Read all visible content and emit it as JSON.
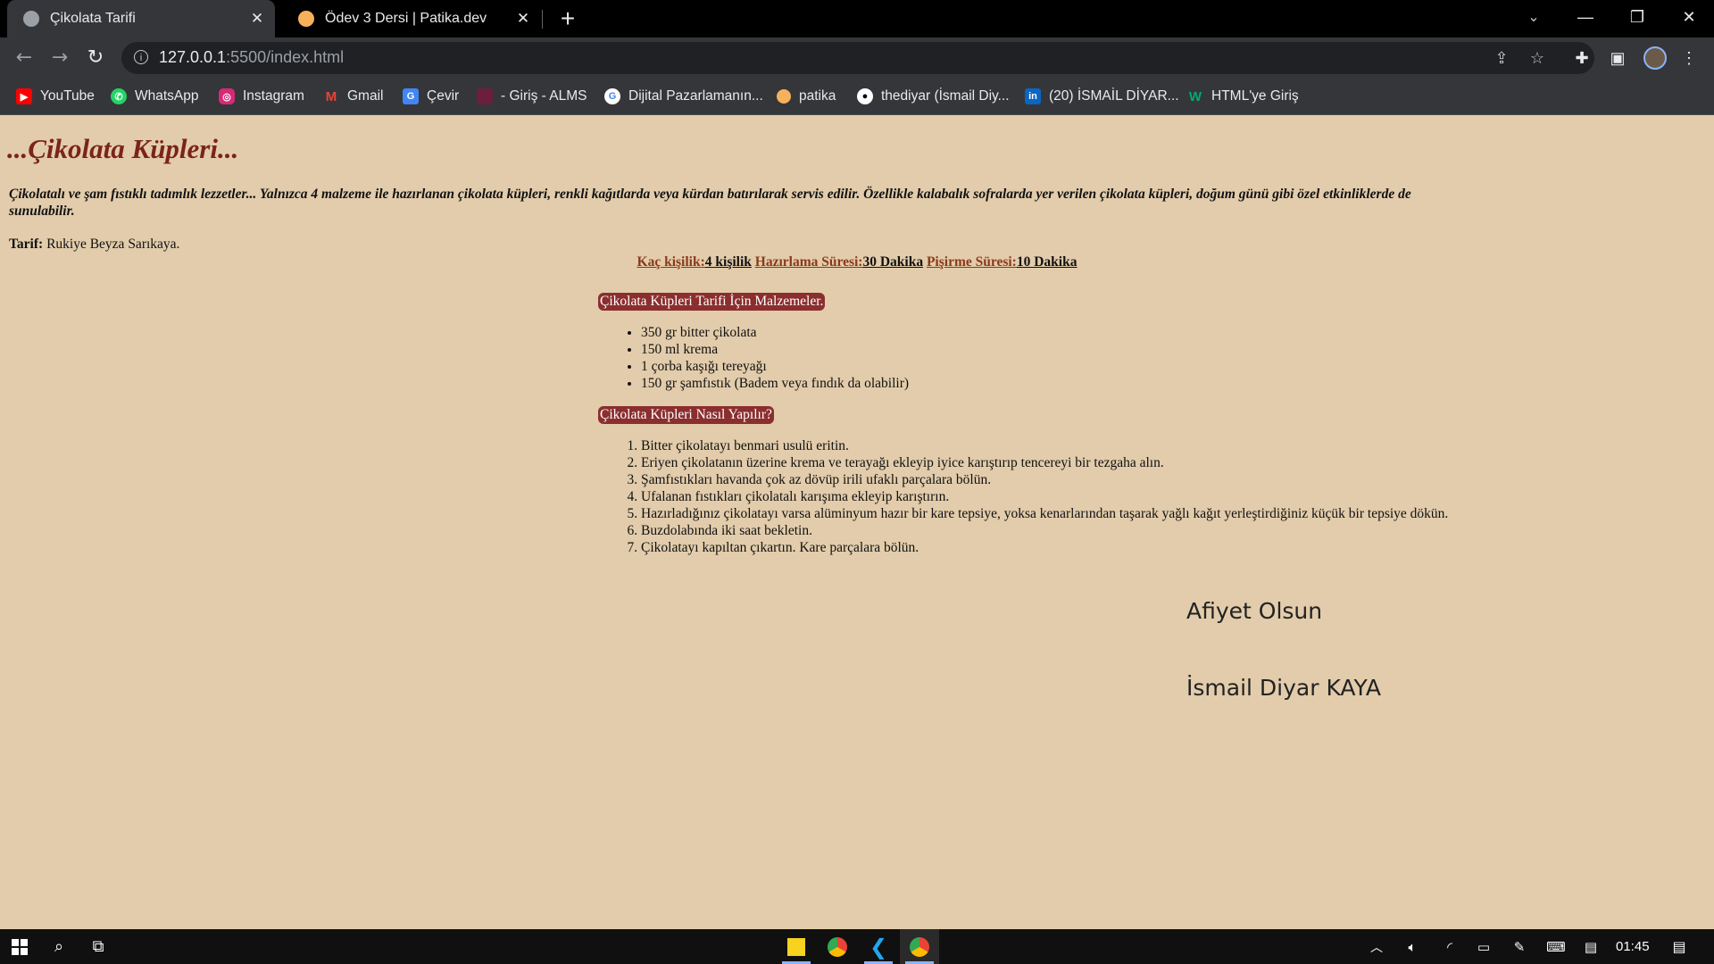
{
  "browser": {
    "tabs": [
      {
        "title": "Çikolata Tarifi",
        "favicon": "globe-icon",
        "active": true
      },
      {
        "title": "Ödev 3 Dersi | Patika.dev",
        "favicon": "patika-icon",
        "active": false
      }
    ],
    "url_host": "127.0.0.1",
    "url_path": ":5500/index.html",
    "bookmarks": [
      {
        "label": "YouTube",
        "icon": "youtube-icon",
        "color": "#ff0000"
      },
      {
        "label": "WhatsApp",
        "icon": "whatsapp-icon",
        "color": "#25d366"
      },
      {
        "label": "Instagram",
        "icon": "instagram-icon",
        "color": "#d62976"
      },
      {
        "label": "Gmail",
        "icon": "gmail-icon",
        "color": "#ea4335"
      },
      {
        "label": "Çevir",
        "icon": "translate-icon",
        "color": "#4285f4"
      },
      {
        "label": "- Giriş - ALMS",
        "icon": "alms-icon",
        "color": "#6b1f3d"
      },
      {
        "label": "Dijital Pazarlamanın...",
        "icon": "google-icon",
        "color": "#ffffff"
      },
      {
        "label": "patika",
        "icon": "patika-icon",
        "color": "#f7b15c"
      },
      {
        "label": "thediyar (İsmail Diy...",
        "icon": "github-icon",
        "color": "#ffffff"
      },
      {
        "label": "(20) İSMAİL DİYAR...",
        "icon": "linkedin-icon",
        "color": "#0a66c2"
      },
      {
        "label": "HTML'ye Giriş",
        "icon": "w3schools-icon",
        "color": "#04aa6d"
      }
    ]
  },
  "page": {
    "title": "...Çikolata Küpleri...",
    "intro": "Çikolatalı ve şam fıstıklı tadımlık lezzetler... Yalnızca 4 malzeme ile hazırlanan çikolata küpleri, renkli kağıtlarda veya kürdan batırılarak servis edilir. Özellikle kalabalık sofralarda yer verilen çikolata küpleri, doğum günü gibi özel etkinliklerde de sunulabilir.",
    "recipe_label": "Tarif:",
    "recipe_author": " Rukiye Beyza Sarıkaya.",
    "meta": {
      "servings_label": "Kaç kişilik:",
      "servings_value": "4 kişilik",
      "prep_label": "Hazırlama Süresi:",
      "prep_value": "30 Dakika",
      "cook_label": "Pişirme Süresi:",
      "cook_value": "10 Dakika"
    },
    "ingredients_heading": "Çikolata Küpleri Tarifi İçin Malzemeler.",
    "ingredients": [
      "350 gr bitter çikolata",
      "150 ml krema",
      "1 çorba kaşığı tereyağı",
      "150 gr şamfıstık (Badem veya fındık da olabilir)"
    ],
    "steps_heading": "Çikolata Küpleri Nasıl Yapılır?",
    "steps": [
      "Bitter çikolatayı benmari usulü eritin.",
      "Eriyen çikolatanın üzerine krema ve terayağı ekleyip iyice karıştırıp tencereyi bir tezgaha alın.",
      "Şamfıstıkları havanda çok az dövüp irili ufaklı parçalara bölün.",
      "Ufalanan fıstıkları çikolatalı karışıma ekleyip karıştırın.",
      "Hazırladığınız çikolatayı varsa alüminyum hazır bir kare tepsiye, yoksa kenarlarından taşarak yağlı kağıt yerleştirdiğiniz küçük bir tepsiye dökün.",
      "Buzdolabında iki saat bekletin.",
      "Çikolatayı kapıltan çıkartın. Kare parçalara bölün."
    ],
    "closing": "Afiyet Olsun",
    "signature": "İsmail Diyar KAYA"
  },
  "taskbar": {
    "time": "01:45"
  }
}
